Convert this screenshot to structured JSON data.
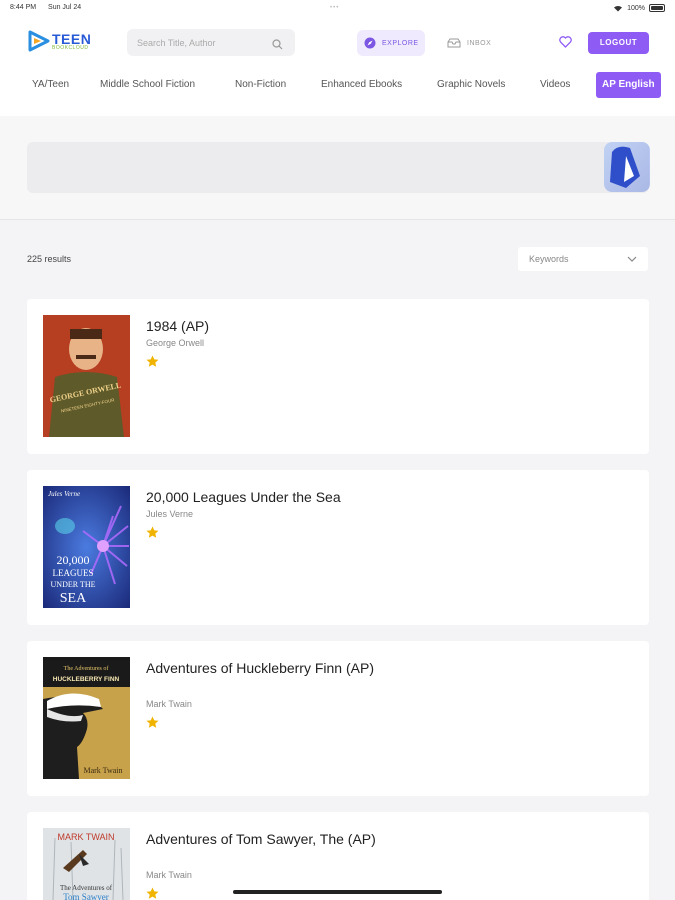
{
  "status_bar": {
    "time": "8:44 PM",
    "date": "Sun Jul 24",
    "battery": "100%"
  },
  "logo": {
    "line1": "TEEN",
    "line2": "BOOKCLOUD"
  },
  "search": {
    "placeholder": "Search Title, Author"
  },
  "nav": {
    "explore_label": "EXPLORE",
    "inbox_label": "INBOX",
    "logout_label": "LOGOUT"
  },
  "categories": [
    "YA/Teen",
    "Middle School Fiction",
    "Non-Fiction",
    "Enhanced Ebooks",
    "Graphic Novels",
    "Videos",
    "AP English"
  ],
  "results": {
    "count": "225 results",
    "sort_label": "Keywords"
  },
  "books": [
    {
      "title": "1984 (AP)",
      "author": "George Orwell"
    },
    {
      "title": "20,000 Leagues Under the Sea",
      "author": "Jules Verne"
    },
    {
      "title": "Adventures of Huckleberry Finn (AP)",
      "author": "Mark Twain"
    },
    {
      "title": "Adventures of Tom Sawyer, The (AP)",
      "author": "Mark Twain"
    }
  ],
  "covers": {
    "c1": {
      "line1": "GEORGE ORWELL",
      "line2": "NINETEEN EIGHTY-FOUR"
    },
    "c2": {
      "line1": "Jules Verne",
      "line2": "20,000",
      "line3": "LEAGUES",
      "line4": "UNDER THE",
      "line5": "SEA"
    },
    "c3": {
      "line1": "The Adventures of",
      "line2": "HUCKLEBERRY FINN",
      "line3": "Mark Twain"
    },
    "c4": {
      "line1": "MARK TWAIN",
      "line2": "The Adventures of",
      "line3": "Tom Sawyer"
    }
  },
  "colors": {
    "accent": "#8f5bf5",
    "star": "#f0b400"
  }
}
